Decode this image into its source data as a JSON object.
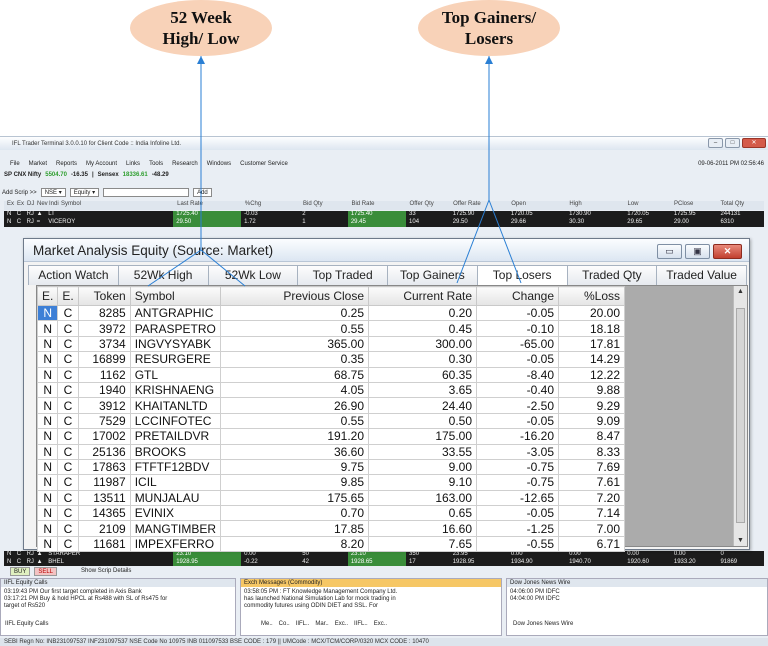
{
  "callouts": {
    "left": "52 Week\nHigh/ Low",
    "left_l1": "52 Week",
    "left_l2": "High/ Low",
    "right_l1": "Top Gainers/",
    "right_l2": "Losers"
  },
  "app": {
    "title": "IFL Trader Terminal 3.0.0.10 for Client Code :: India Infoline Ltd.",
    "date": "09-06-2011 PM 02:56:46",
    "menu": [
      "File",
      "Market",
      "Reports",
      "My Account",
      "Links",
      "Tools",
      "Research",
      "Windows",
      "Customer Service"
    ],
    "index": {
      "nifty_label": "SP CNX Nifty",
      "nifty_value": "5504.70",
      "nifty_change": "-16.35",
      "sensex_label": "Sensex",
      "sensex_value": "18336.61",
      "sensex_change": "-48.29"
    },
    "addscrip": {
      "label": "Add Scrip >>",
      "exchange": "NSE",
      "segment": "Equity",
      "add_button": "Add"
    },
    "watch_headers": [
      "Ex",
      "Ex",
      "DJ",
      "Nev",
      "Indi",
      "Symbol",
      "Last Rate",
      "%Chg",
      "Bid Qty",
      "Bid Rate",
      "Offer Qty",
      "Offer Rate",
      "Open",
      "High",
      "Low",
      "PClose",
      "Total Qty"
    ],
    "watch_rows": [
      {
        "c": [
          "N",
          "C",
          "RJ",
          "▲",
          "LT",
          "1725.40",
          "-0.03",
          "2",
          "1725.40",
          "33",
          "1725.90",
          "1720.05",
          "1730.90",
          "1720.05",
          "1725.95",
          "244131"
        ]
      },
      {
        "c": [
          "N",
          "C",
          "RJ",
          "=",
          "VICEROY",
          "29.50",
          "1.72",
          "1",
          "29.45",
          "104",
          "29.50",
          "29.66",
          "30.30",
          "29.65",
          "29.00",
          "6310"
        ]
      },
      {
        "c": [
          "N",
          "C",
          "RJ",
          "▲",
          "STARAPER",
          "23.10",
          "0.00",
          "50",
          "23.10",
          "350",
          "23.95",
          "0.00",
          "0.00",
          "0.00",
          "0.00",
          "0"
        ]
      },
      {
        "c": [
          "N",
          "C",
          "RJ",
          "▲",
          "BHEL",
          "1928.95",
          "-0.22",
          "42",
          "1928.65",
          "17",
          "1928.95",
          "1934.90",
          "1940.70",
          "1920.60",
          "1933.20",
          "91869"
        ]
      }
    ]
  },
  "bottom": {
    "buy": "BUY",
    "sell": "SELL",
    "show_details": "Show Scrip Details",
    "panel1": {
      "title": "IIFL Equity Calls",
      "lines": [
        "03:19:43 PM Our first target completed in Axis Bank",
        "03:17:21 PM Buy & hold HPCL at Rs488 with SL of Rs475 for",
        "target of Rs520"
      ],
      "tab": "IIFL Equity Calls"
    },
    "panel2": {
      "title": "Exch Messages (Commodity)",
      "lines": [
        "03:58:05 PM : FT Knowledge Management Company Ltd.",
        "has launched National Simulation Lab for mock trading in",
        "commodity futures using ODIN DIET and SSL.  For"
      ],
      "tabs": [
        "Me..",
        "Co..",
        "IIFL..",
        "Mar..",
        "Exc..",
        "IIFL..",
        "Exc.."
      ]
    },
    "panel3": {
      "title": "Dow Jones News Wire",
      "lines": [
        "04:06:00 PM    IDFC",
        "04:04:00 PM    IDFC"
      ],
      "tab": "Dow Jones News Wire"
    },
    "status": "SEBI Regn No: INB231097537  INF231097537  NSE Code No 10975  INB 011097533  BSE CODE : 179  ||  UMCode : MCX/TCM/CORP/0320  MCX CODE : 10470"
  },
  "popup": {
    "title": "Market Analysis Equity (Source: Market)",
    "tabs": [
      "Action Watch",
      "52Wk High",
      "52Wk Low",
      "Top Traded",
      "Top Gainers",
      "Top Losers",
      "Traded Qty",
      "Traded Value"
    ],
    "columns": [
      "E.",
      "E.",
      "Token",
      "Symbol",
      "Previous Close",
      "Current Rate",
      "Change",
      "%Loss"
    ],
    "rows": [
      [
        "N",
        "C",
        "8285",
        "ANTGRAPHIC",
        "0.25",
        "0.20",
        "-0.05",
        "20.00"
      ],
      [
        "N",
        "C",
        "3972",
        "PARASPETRO",
        "0.55",
        "0.45",
        "-0.10",
        "18.18"
      ],
      [
        "N",
        "C",
        "3734",
        "INGVYSYABK",
        "365.00",
        "300.00",
        "-65.00",
        "17.81"
      ],
      [
        "N",
        "C",
        "16899",
        "RESURGERE",
        "0.35",
        "0.30",
        "-0.05",
        "14.29"
      ],
      [
        "N",
        "C",
        "1162",
        "GTL",
        "68.75",
        "60.35",
        "-8.40",
        "12.22"
      ],
      [
        "N",
        "C",
        "1940",
        "KRISHNAENG",
        "4.05",
        "3.65",
        "-0.40",
        "9.88"
      ],
      [
        "N",
        "C",
        "3912",
        "KHAITANLTD",
        "26.90",
        "24.40",
        "-2.50",
        "9.29"
      ],
      [
        "N",
        "C",
        "7529",
        "LCCINFOTEC",
        "0.55",
        "0.50",
        "-0.05",
        "9.09"
      ],
      [
        "N",
        "C",
        "17002",
        "PRETAILDVR",
        "191.20",
        "175.00",
        "-16.20",
        "8.47"
      ],
      [
        "N",
        "C",
        "25136",
        "BROOKS",
        "36.60",
        "33.55",
        "-3.05",
        "8.33"
      ],
      [
        "N",
        "C",
        "17863",
        "FTFTF12BDV",
        "9.75",
        "9.00",
        "-0.75",
        "7.69"
      ],
      [
        "N",
        "C",
        "11987",
        "ICIL",
        "9.85",
        "9.10",
        "-0.75",
        "7.61"
      ],
      [
        "N",
        "C",
        "13511",
        "MUNJALAU",
        "175.65",
        "163.00",
        "-12.65",
        "7.20"
      ],
      [
        "N",
        "C",
        "14365",
        "EVINIX",
        "0.70",
        "0.65",
        "-0.05",
        "7.14"
      ],
      [
        "N",
        "C",
        "2109",
        "MANGTIMBER",
        "17.85",
        "16.60",
        "-1.25",
        "7.00"
      ],
      [
        "N",
        "C",
        "11681",
        "IMPEXFERRO",
        "8.20",
        "7.65",
        "-0.55",
        "6.71"
      ]
    ]
  }
}
